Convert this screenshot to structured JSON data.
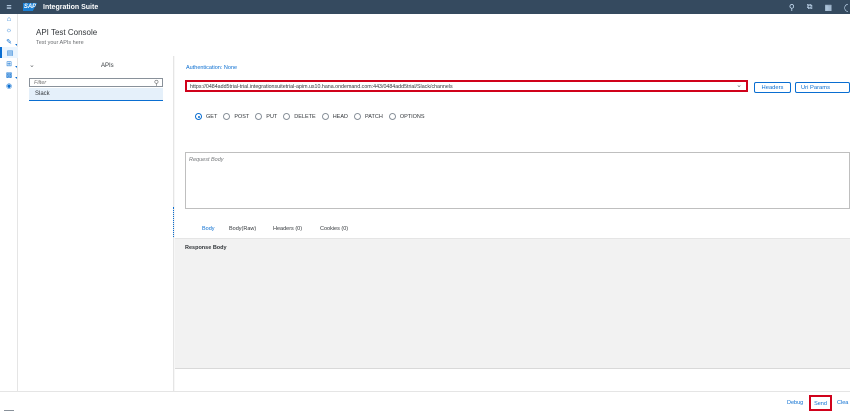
{
  "shell": {
    "logo": "SAP",
    "title": "Integration Suite",
    "icons": [
      "menu-icon",
      "help-icon",
      "copy-icon",
      "grid-icon"
    ]
  },
  "leftnav": {
    "items": [
      "home-icon",
      "discover-icon",
      "design-icon",
      "test-icon",
      "configure-icon",
      "monitor-icon",
      "settings-icon"
    ]
  },
  "header": {
    "title": "API Test Console",
    "subtitle": "Test your APIs here"
  },
  "apis": {
    "header": "APIs",
    "filter_placeholder": "Filter",
    "items": [
      "Slack"
    ]
  },
  "request": {
    "authentication": "Authentication: None",
    "url": "https://0484add5trial-trial.integrationsuitetrial-apim.us10.hana.ondemand.com:443/0484add5trial/Slack/channels",
    "headers_button": "Headers",
    "uri_params_button": "Uri Params",
    "methods": [
      "GET",
      "POST",
      "PUT",
      "DELETE",
      "HEAD",
      "PATCH",
      "OPTIONS"
    ],
    "selected_method": "GET",
    "body_placeholder": "Request Body"
  },
  "response": {
    "tabs": [
      "Body",
      "Body(Raw)",
      "Headers (0)",
      "Cookies (0)"
    ],
    "active_tab": "Body",
    "label": "Response Body"
  },
  "footer": {
    "debug": "Debug",
    "send": "Send",
    "clear": "Clea"
  },
  "colors": {
    "shell": "#354a5f",
    "accent": "#0a6ed1",
    "highlight": "#d0021b"
  }
}
